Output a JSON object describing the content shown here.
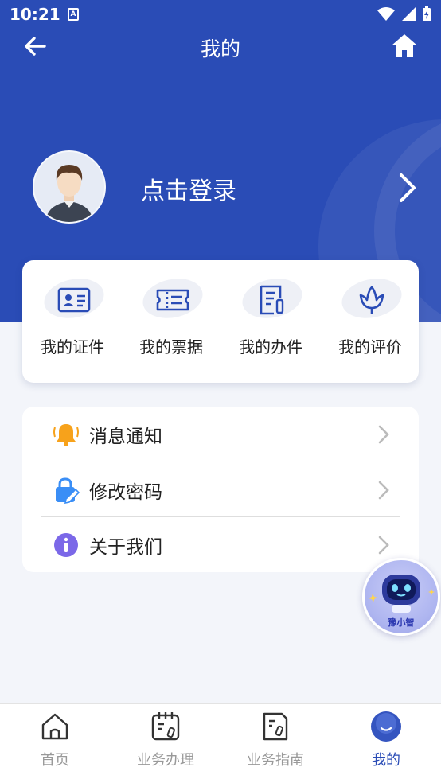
{
  "status_bar": {
    "time": "10:21",
    "notification_letter": "A"
  },
  "header": {
    "title": "我的"
  },
  "profile": {
    "login_text": "点击登录"
  },
  "quick_actions": [
    {
      "label": "我的证件",
      "icon": "id-card-icon"
    },
    {
      "label": "我的票据",
      "icon": "ticket-icon"
    },
    {
      "label": "我的办件",
      "icon": "document-icon"
    },
    {
      "label": "我的评价",
      "icon": "flower-icon"
    }
  ],
  "menu": [
    {
      "label": "消息通知",
      "icon": "bell-icon",
      "color": "#f7a21b"
    },
    {
      "label": "修改密码",
      "icon": "lock-edit-icon",
      "color": "#3a8ef6"
    },
    {
      "label": "关于我们",
      "icon": "info-icon",
      "color": "#7b68e8"
    }
  ],
  "assistant": {
    "label": "豫小智"
  },
  "tabs": [
    {
      "label": "首页",
      "icon": "home-icon",
      "active": false
    },
    {
      "label": "业务办理",
      "icon": "calendar-doc-icon",
      "active": false
    },
    {
      "label": "业务指南",
      "icon": "guide-doc-icon",
      "active": false
    },
    {
      "label": "我的",
      "icon": "profile-icon",
      "active": true
    }
  ],
  "colors": {
    "primary": "#2a4cb6",
    "background": "#f3f5fa",
    "inactive": "#999999"
  }
}
